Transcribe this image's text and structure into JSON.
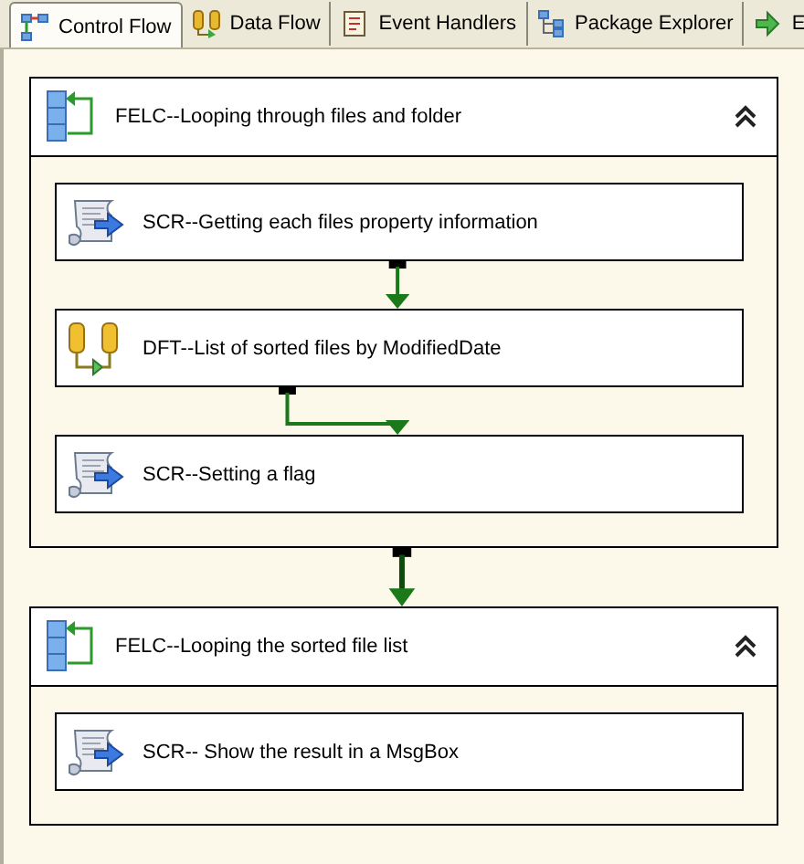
{
  "tabs": [
    {
      "label": "Control Flow",
      "kind": "control",
      "selected": true
    },
    {
      "label": "Data Flow",
      "kind": "data",
      "selected": false
    },
    {
      "label": "Event Handlers",
      "kind": "events",
      "selected": false
    },
    {
      "label": "Package Explorer",
      "kind": "explorer",
      "selected": false
    },
    {
      "label": "E",
      "kind": "run",
      "selected": false
    }
  ],
  "containers": [
    {
      "title": "FELC--Looping through files and folder",
      "expanded": true,
      "tasks": [
        {
          "label": "SCR--Getting each files property information",
          "kind": "script"
        },
        {
          "label": "DFT--List of sorted files by ModifiedDate",
          "kind": "dataflow"
        },
        {
          "label": "SCR--Setting a flag",
          "kind": "script"
        }
      ],
      "connectors": [
        {
          "kind": "straight"
        },
        {
          "kind": "elbow"
        }
      ]
    },
    {
      "title": "FELC--Looping the sorted file list",
      "expanded": true,
      "tasks": [
        {
          "label": "SCR-- Show the result in a MsgBox",
          "kind": "script"
        }
      ]
    }
  ],
  "connectors": [
    {
      "kind": "straight"
    }
  ]
}
